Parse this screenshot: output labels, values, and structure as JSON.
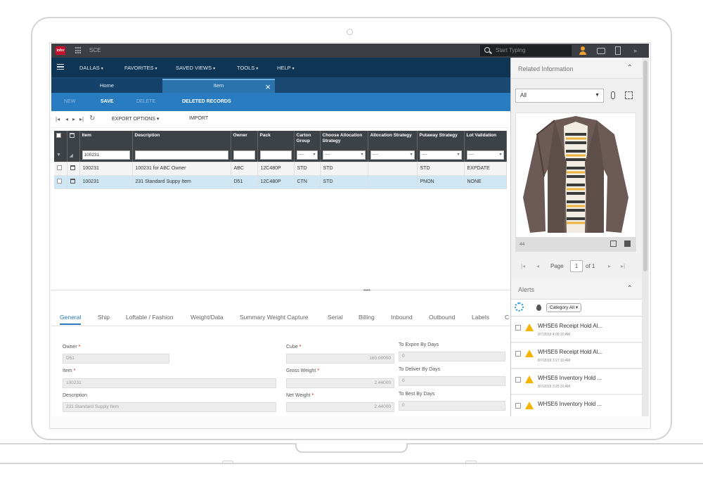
{
  "topbar": {
    "logo": "infor",
    "app_title": "SCE",
    "search_placeholder": "Start Typing"
  },
  "menu": [
    {
      "label": "DALLAS"
    },
    {
      "label": "FAVORITES"
    },
    {
      "label": "SAVED VIEWS"
    },
    {
      "label": "TOOLS"
    },
    {
      "label": "HELP"
    }
  ],
  "tabs": {
    "home": "Home",
    "item": "Item"
  },
  "actions": {
    "new": "NEW",
    "save": "SAVE",
    "delete": "DELETE",
    "deleted_records": "DELETED RECORDS"
  },
  "toolbar": {
    "export": "EXPORT OPTIONS",
    "import": "IMPORT"
  },
  "grid": {
    "headers": [
      "Item",
      "Description",
      "Owner",
      "Pack",
      "Carton Group",
      "Choose Allocation Strategy",
      "Allocation Strategy",
      "Putaway Strategy",
      "Lot Validation"
    ],
    "filter_item": "100231",
    "filter_select": "----",
    "rows": [
      [
        "100231",
        "100231 for ABC Owner",
        "ABC",
        "12C480P",
        "STD",
        "STD",
        "",
        "STD",
        "EXPDATE"
      ],
      [
        "100231",
        "231 Standard Suppy Item",
        "D51",
        "12C480P",
        "CTN",
        "STD",
        "",
        "PNON",
        "NONE"
      ]
    ]
  },
  "subtabs": [
    "General",
    "Ship",
    "Loftable / Fashion",
    "Weight/Data",
    "Summary Weight Capture",
    "Serial",
    "Billing",
    "Inbound",
    "Outbound",
    "Labels",
    "C"
  ],
  "form": {
    "owner_label": "Owner",
    "owner_value": "D51",
    "item_label": "Item",
    "item_value": "100231",
    "description_label": "Description",
    "description_value": "231 Standard Supply Item",
    "cube_label": "Cube",
    "cube_value": "160.00000",
    "gross_label": "Gross Weight",
    "gross_value": "2.44000",
    "net_label": "Net Weight",
    "net_value": "2.44000",
    "expire_label": "To Expire By Days",
    "expire_value": "0",
    "deliver_label": "To Deliver By Days",
    "deliver_value": "0",
    "best_label": "To Best By Days",
    "best_value": "0"
  },
  "right_panel": {
    "related_title": "Related Information",
    "filter_value": "All",
    "image_caption": "44",
    "page_label": "Page",
    "page_value": "1",
    "page_of": "of 1",
    "alerts_title": "Alerts",
    "category_chip": "Category All",
    "alerts": [
      {
        "title": "WHSE6 Receipt Hold Al...",
        "time": "8/7/2019 4:09:10 AM"
      },
      {
        "title": "WHSE6 Receipt Hold Al...",
        "time": "8/7/2019 3:27:10 AM"
      },
      {
        "title": "WHSE6 Inventory Hold ...",
        "time": "8/7/2019 3:25:10 AM"
      },
      {
        "title": "WHSE6 Inventory Hold ...",
        "time": ""
      }
    ]
  },
  "colors": {
    "menubar": "#0f3555",
    "actionbar": "#2a7cc0",
    "grid_header": "#3d4247",
    "selected_row": "#cfe6f5",
    "brand": "#c8102e",
    "warning": "#f5b400"
  }
}
